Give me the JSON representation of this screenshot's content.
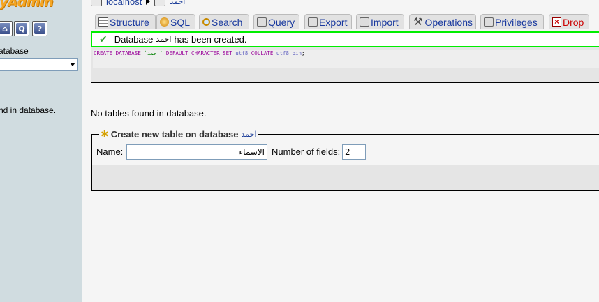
{
  "nav": {
    "logo": "nyAdmin",
    "buttons": [
      {
        "icon": "home-icon",
        "glyph": "⌂"
      },
      {
        "icon": "query-window-icon",
        "glyph": "Q"
      },
      {
        "icon": "docs-icon",
        "glyph": "?"
      }
    ],
    "database_label": "atabase",
    "database_select_value": "",
    "no_tables_text": "nd in database."
  },
  "breadcrumb": {
    "server": "localhost",
    "database": "احمد"
  },
  "tabs": [
    {
      "label": "Structure",
      "icon": "structure-icon"
    },
    {
      "label": "SQL",
      "icon": "sql-icon"
    },
    {
      "label": "Search",
      "icon": "search-icon"
    },
    {
      "label": "Query",
      "icon": "query-icon"
    },
    {
      "label": "Export",
      "icon": "export-icon"
    },
    {
      "label": "Import",
      "icon": "import-icon"
    },
    {
      "label": "Operations",
      "icon": "operations-icon"
    },
    {
      "label": "Privileges",
      "icon": "privileges-icon"
    },
    {
      "label": "Drop",
      "icon": "drop-icon"
    }
  ],
  "message": {
    "prefix": "Database",
    "dbname": "احمد",
    "suffix": "has been created."
  },
  "sql": {
    "kw1": "CREATE DATABASE",
    "name": "`احمد`",
    "kw2": "DEFAULT CHARACTER SET",
    "charset": "utf8",
    "kw3": "COLLATE",
    "collation": "utf8_bin",
    "end": ";"
  },
  "main": {
    "no_tables": "No tables found in database."
  },
  "create_table": {
    "legend": "Create new table on database",
    "dbname": "احمد",
    "name_label": "Name:",
    "name_value": "الاسماء",
    "fields_label": "Number of fields:",
    "fields_value": "2"
  },
  "colors": {
    "success_border": "#00ee00",
    "link": "#1a3c98",
    "drop": "#cc0000",
    "nav_bg": "#d0dce0"
  }
}
